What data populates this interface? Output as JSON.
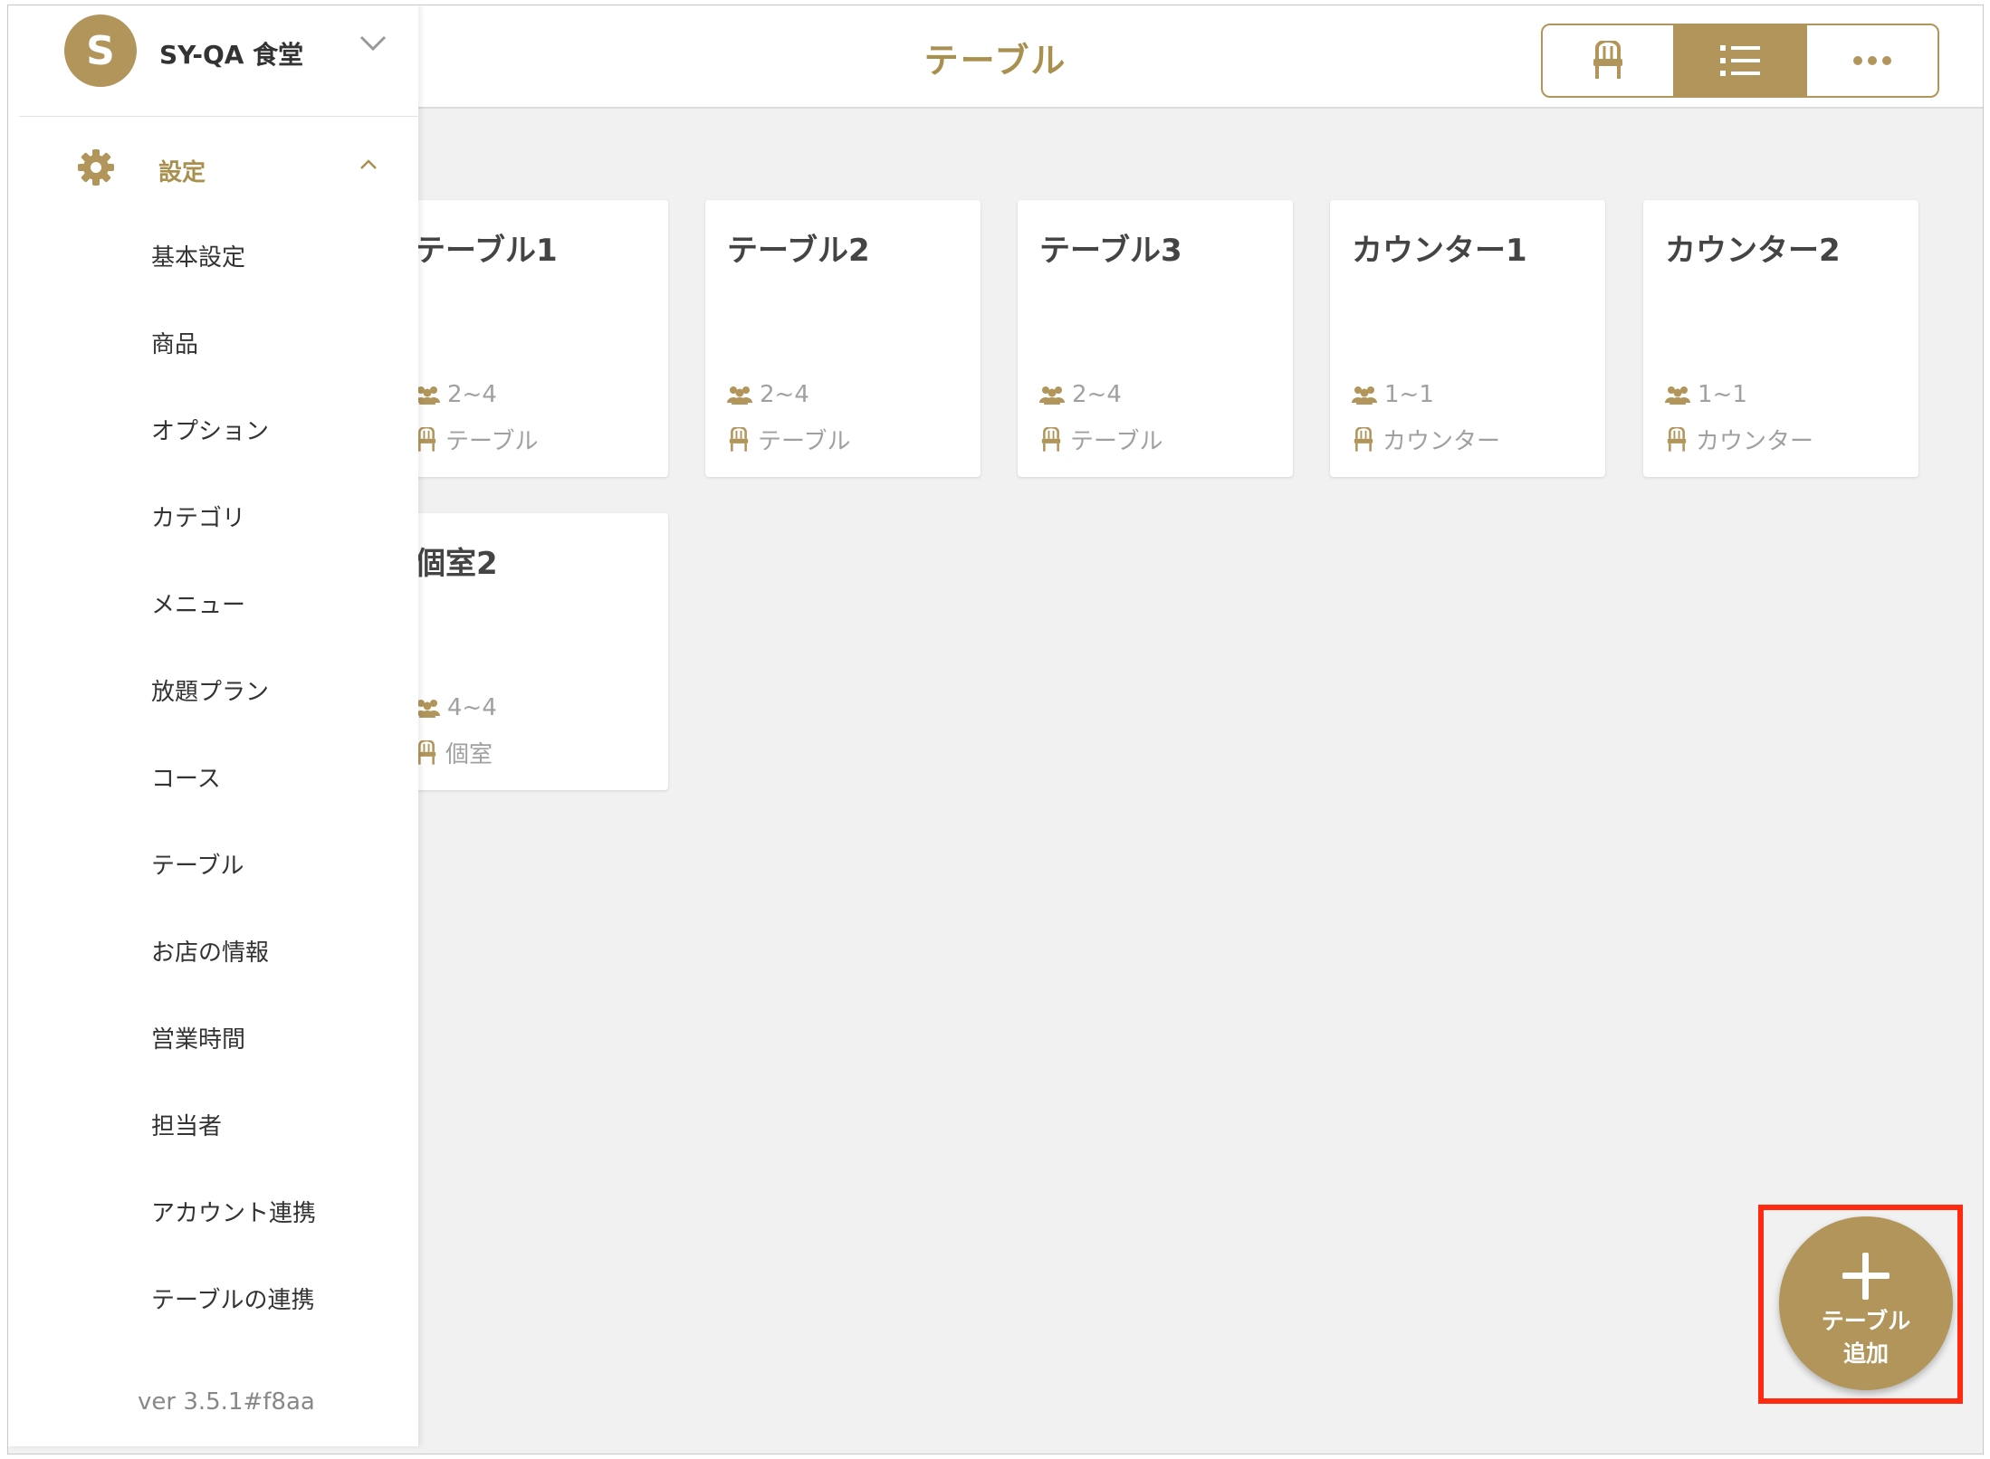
{
  "header": {
    "title": "テーブル"
  },
  "view_switcher": {
    "items": [
      {
        "icon": "chair-icon",
        "active": false
      },
      {
        "icon": "list-icon",
        "active": true
      },
      {
        "icon": "more-icon",
        "active": false
      }
    ]
  },
  "account": {
    "avatar_letter": "S",
    "store_name": "SY-QA 食堂"
  },
  "sidebar": {
    "section_label": "設定",
    "items": [
      "基本設定",
      "商品",
      "オプション",
      "カテゴリ",
      "メニュー",
      "放題プラン",
      "コース",
      "テーブル",
      "お店の情報",
      "営業時間",
      "担当者",
      "アカウント連携",
      "テーブルの連携"
    ],
    "version": "ver 3.5.1#f8aa"
  },
  "tables": [
    {
      "name": "テーブル1",
      "capacity": "2~4",
      "type": "テーブル"
    },
    {
      "name": "テーブル2",
      "capacity": "2~4",
      "type": "テーブル"
    },
    {
      "name": "テーブル3",
      "capacity": "2~4",
      "type": "テーブル"
    },
    {
      "name": "カウンター1",
      "capacity": "1~1",
      "type": "カウンター"
    },
    {
      "name": "カウンター2",
      "capacity": "1~1",
      "type": "カウンター"
    },
    {
      "name": "個室2",
      "capacity": "4~4",
      "type": "個室"
    }
  ],
  "fab": {
    "line1": "テーブル",
    "line2": "追加"
  },
  "colors": {
    "accent": "#b1955a",
    "highlight": "#ff2a0f",
    "background": "#f1f1f1"
  }
}
